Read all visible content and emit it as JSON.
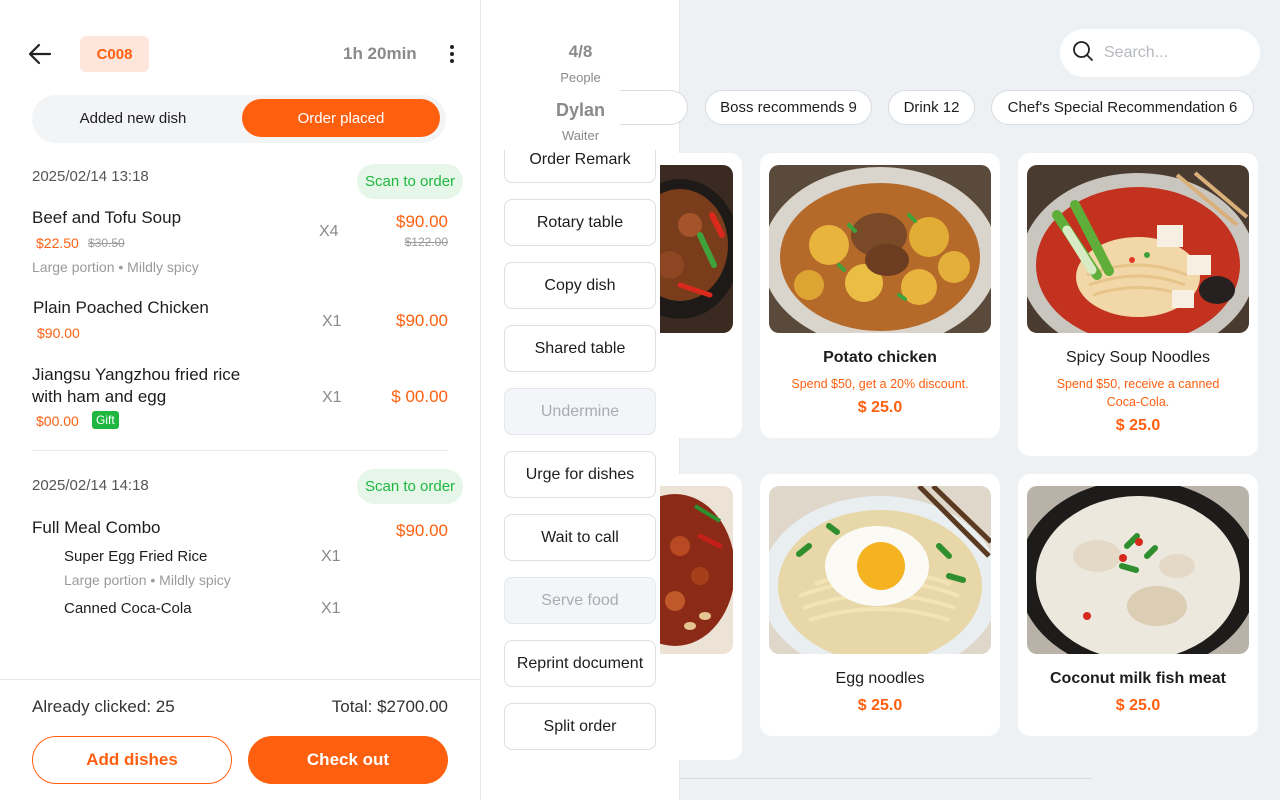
{
  "header": {
    "table_code": "C008",
    "timer": "1h 20min"
  },
  "tabs": {
    "added": "Added new dish",
    "placed": "Order placed"
  },
  "orders": [
    {
      "datetime": "2025/02/14 13:18",
      "badge": "Scan to order",
      "items": [
        {
          "name": "Beef and Tofu Soup",
          "unit_price": "$22.50",
          "orig_unit": "$30.50",
          "attrs": "Large portion • Mildly spicy",
          "qty": "X4",
          "total": "$90.00",
          "orig_total": "$122.00"
        },
        {
          "name": "Plain Poached Chicken",
          "unit_price": "$90.00",
          "qty": "X1",
          "total": "$90.00"
        },
        {
          "name_line1": "Jiangsu Yangzhou fried rice",
          "name_line2": "with ham and egg",
          "unit_price": "$00.00",
          "gift": "Gift",
          "qty": "X1",
          "total": "$ 00.00"
        }
      ]
    },
    {
      "datetime": "2025/02/14 14:18",
      "badge": "Scan to order",
      "combo": {
        "name": "Full Meal Combo",
        "total": "$90.00",
        "subitems": [
          {
            "name": "Super Egg Fried Rice",
            "attrs": "Large portion • Mildly spicy",
            "qty": "X1"
          },
          {
            "name": "Canned Coca-Cola",
            "qty": "X1"
          }
        ]
      }
    }
  ],
  "footer": {
    "clicked": "Already clicked: 25",
    "total": "Total: $2700.00",
    "add_label": "Add dishes",
    "checkout_label": "Check out"
  },
  "middle": {
    "people_count": "4/8",
    "people_label": "People",
    "waiter_name": "Dylan",
    "waiter_label": "Waiter",
    "actions": [
      {
        "label": "Order Remark",
        "disabled": false
      },
      {
        "label": "Rotary table",
        "disabled": false
      },
      {
        "label": "Copy dish",
        "disabled": false
      },
      {
        "label": "Shared table",
        "disabled": false
      },
      {
        "label": "Undermine",
        "disabled": true
      },
      {
        "label": "Urge for dishes",
        "disabled": false
      },
      {
        "label": "Wait to call",
        "disabled": false
      },
      {
        "label": "Serve food",
        "disabled": true
      },
      {
        "label": "Reprint document",
        "disabled": false
      },
      {
        "label": "Split order",
        "disabled": false
      }
    ]
  },
  "search": {
    "placeholder": "Search..."
  },
  "categories": [
    "Boss recommends 9",
    "Drink 12",
    "Chef's Special Recommendation 6"
  ],
  "dishes": [
    {
      "name": "Potato chicken",
      "promo": "Spend $50, get a 20% discount.",
      "price": "$ 25.0"
    },
    {
      "name": "Spicy Soup Noodles",
      "promo_line1": "Spend $50, receive a canned",
      "promo_line2": "Coca-Cola.",
      "price": "$ 25.0"
    },
    {
      "name": "Egg noodles",
      "price": "$ 25.0"
    },
    {
      "name": "Coconut milk fish meat",
      "price": "$ 25.0"
    }
  ],
  "colors": {
    "accent": "#ff6010",
    "success": "#1fb740",
    "background": "#eef1f4"
  }
}
